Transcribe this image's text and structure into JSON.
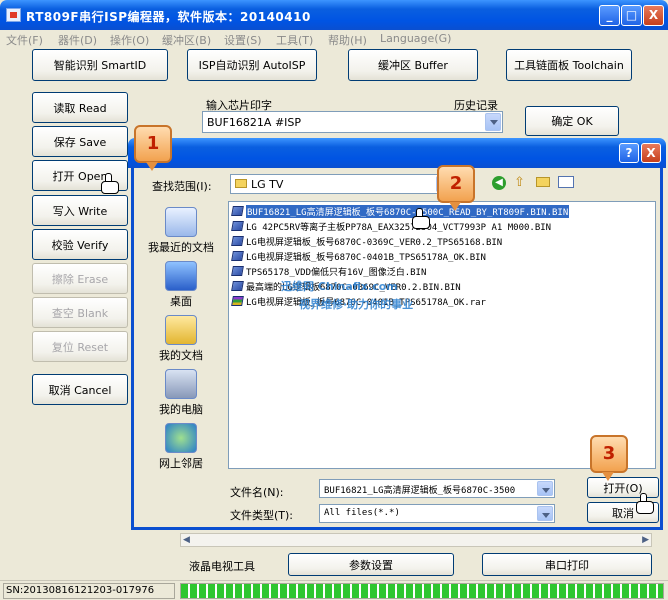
{
  "window": {
    "title": "RT809F串行ISP编程器，软件版本：20140410",
    "controls": {
      "minimize": "_",
      "maximize": "□",
      "close": "X"
    }
  },
  "menu": [
    "文件(F)",
    "器件(D)",
    "操作(O)",
    "缓冲区(B)",
    "设置(S)",
    "工具(T)",
    "帮助(H)",
    "Language(G)"
  ],
  "toolbar": {
    "smart_id": "智能识别 SmartID",
    "isp_auto": "ISP自动识别 AutoISP",
    "buffer": "缓冲区 Buffer",
    "toolchain": "工具链面板 Toolchain"
  },
  "chip": {
    "input_label": "输入芯片印字",
    "history_label": "历史记录",
    "value": "BUF16821A #ISP",
    "confirm": "确定 OK"
  },
  "side_buttons": [
    "读取 Read",
    "保存 Save",
    "打开 Open",
    "写入 Write",
    "校验 Verify",
    "擦除 Erase",
    "查空 Blank",
    "复位 Reset",
    "取消 Cancel"
  ],
  "dialog": {
    "help": "?",
    "close": "X",
    "lookin_label": "查找范围(I):",
    "lookin_value": "LG TV",
    "places": [
      "我最近的文档",
      "桌面",
      "我的文档",
      "我的电脑",
      "网上邻居"
    ],
    "files": [
      "BUF16821_LG高清屏逻辑板_板号6870C-3500C_READ_BY_RT809F.BIN.BIN",
      "LG 42PC5RV等离子主板PP78A_EAX32572504_VCT7993P A1 M000.BIN",
      "LG电视屏逻辑板_板号6870C-0369C_VER0.2_TPS65168.BIN",
      "LG电视屏逻辑板_板号6870C-0401B_TPS65178A_OK.BIN",
      "TPS65178_VDD偏低只有16V_图像泛白.BIN",
      "最高端的LG逻辑板6870C-0369C_VER0.2.BIN.BIN",
      "LG电视屏逻辑板_板号6870C-0401B_TPS65178A_OK.rar"
    ],
    "watermark_1": "迅维网 Chinafix.com",
    "watermark_2": "视界维修·助力你的事业",
    "filename_label": "文件名(N):",
    "filename_value": "BUF16821_LG高清屏逻辑板_板号6870C-3500",
    "filetype_label": "文件类型(T):",
    "filetype_value": "All files(*.*)",
    "open": "打开(O)",
    "cancel": "取消"
  },
  "callouts": [
    "1",
    "2",
    "3"
  ],
  "bottom": {
    "lcd_tools": "液晶电视工具",
    "params": "参数设置",
    "serial_print": "串口打印"
  },
  "status": {
    "sn": "SN:20130816121203-017976",
    "progress": 1.0
  },
  "colors": {
    "title_blue": "#0054e3",
    "progress_green": "#2fc62f",
    "callout_orange": "#f2a24f",
    "callout_text": "#c02000"
  }
}
